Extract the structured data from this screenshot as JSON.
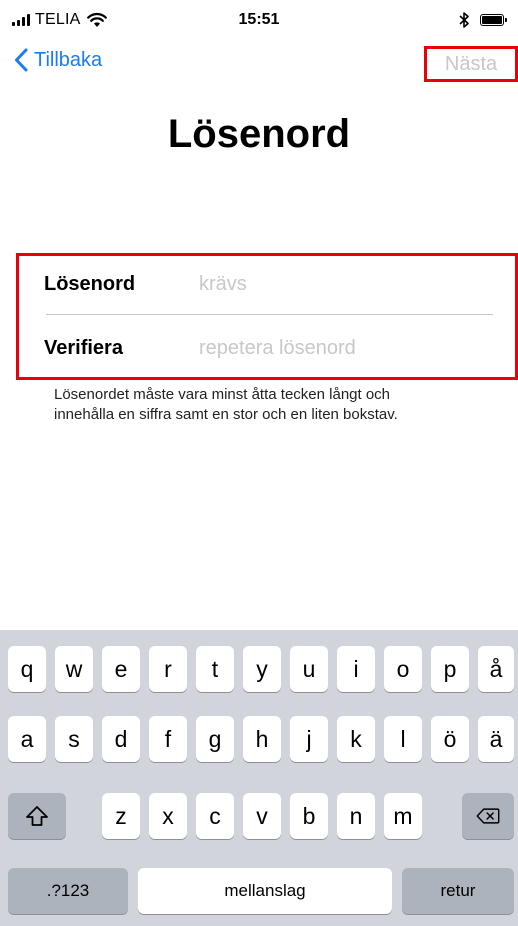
{
  "status_bar": {
    "carrier": "TELIA",
    "time": "15:51",
    "icons": [
      "signal-icon",
      "wifi-icon",
      "bluetooth-icon",
      "battery-icon"
    ]
  },
  "nav": {
    "back_label": "Tillbaka",
    "next_label": "Nästa"
  },
  "title": "Lösenord",
  "form": {
    "password_label": "Lösenord",
    "password_placeholder": "krävs",
    "verify_label": "Verifiera",
    "verify_placeholder": "repetera lösenord"
  },
  "help_text": "Lösenordet måste vara minst åtta tecken långt och innehålla en siffra samt en stor och en liten bokstav.",
  "keyboard": {
    "row1": [
      "q",
      "w",
      "e",
      "r",
      "t",
      "y",
      "u",
      "i",
      "o",
      "p",
      "å"
    ],
    "row2": [
      "a",
      "s",
      "d",
      "f",
      "g",
      "h",
      "j",
      "k",
      "l",
      "ö",
      "ä"
    ],
    "row3": [
      "z",
      "x",
      "c",
      "v",
      "b",
      "n",
      "m"
    ],
    "numbers_label": ".?123",
    "space_label": "mellanslag",
    "return_label": "retur"
  },
  "colors": {
    "accent": "#1a7cf5",
    "highlight_box": "#e8000b",
    "placeholder": "#c7c7cc",
    "keyboard_bg": "#d1d4da"
  }
}
